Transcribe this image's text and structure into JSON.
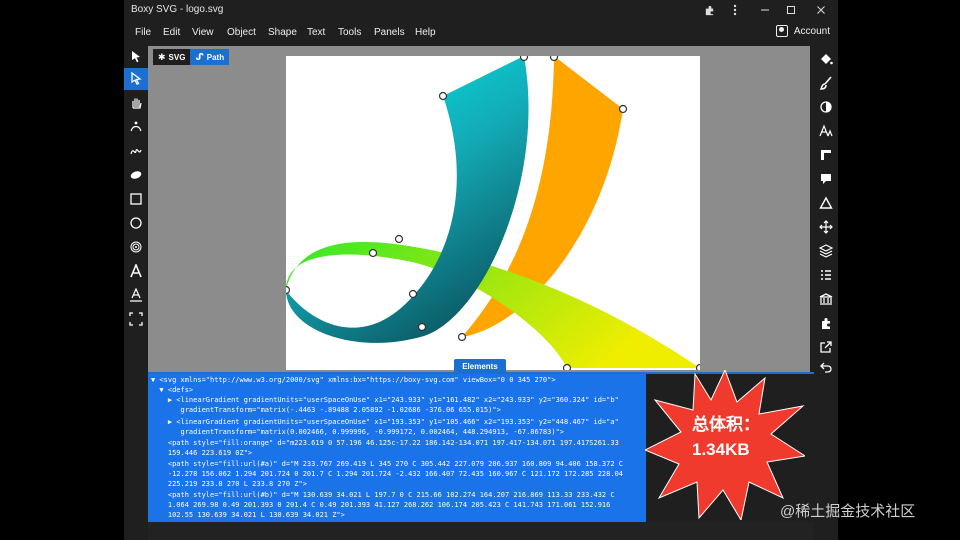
{
  "window": {
    "title": "Boxy SVG - logo.svg"
  },
  "menu": {
    "items": [
      "File",
      "Edit",
      "View",
      "Object",
      "Shape",
      "Text",
      "Tools",
      "Panels",
      "Help"
    ],
    "account_label": "Account"
  },
  "breadcrumbs": {
    "svg_label": "SVG",
    "path_label": "Path"
  },
  "panel": {
    "tab_label": "Elements"
  },
  "code": {
    "lines": [
      "▼ <svg xmlns=\"http://www.w3.org/2000/svg\" xmlns:bx=\"https://boxy-svg.com\" viewBox=\"0 0 345 270\">",
      "  ▼ <defs>",
      "    ▶ <linearGradient gradientUnits=\"userSpaceOnUse\" x1=\"243.933\" y1=\"161.482\" x2=\"243.933\" y2=\"360.324\" id=\"b\"",
      "       gradientTransform=\"matrix(-.4463 -.89488 2.05892 -1.02686 -376.06 655.015)\">",
      "    ▶ <linearGradient gradientUnits=\"userSpaceOnUse\" x1=\"193.353\" y1=\"105.466\" x2=\"193.353\" y2=\"448.467\" id=\"a\"",
      "       gradientTransform=\"matrix(0.002466, 0.999996, -0.999172, 0.002464, 448.294913, -67.86783)\">",
      "    <path style=\"fill:orange\" d=\"m223.619 0 57.196 46.125c-17.22 186.142-134.071 197.417-134.071 197.417S261.33",
      "    159.446 223.619 0Z\">",
      "    <path style=\"fill:url(#a)\" d=\"M 233.767 269.419 L 345 270 C 305.442 227.079 206.937 160.809 94.406 158.372 C",
      "    -12.278 156.062 1.294 201.724 0 201.7 C 1.294 201.724 -2.432 166.407 72.435 160.967 C 121.172 172.285 228.04",
      "    225.219 233.8 270 L 233.8 270 Z\">",
      "    <path style=\"fill:url(#b)\" d=\"M 130.639 34.021 L 197.7 0 C 215.66 102.274 164.207 216.869 113.33 233.432 C",
      "    1.064 269.98 0.49 201.393 0 201.4 C 0.49 201.393 41.127 268.262 106.174 205.423 C 141.743 171.061 152.916",
      "    102.55 130.639 34.021 L 130.639 34.021 Z\">"
    ]
  },
  "overlay": {
    "size_label": "总体积：",
    "size_value": "1.34KB"
  },
  "watermark": "@稀土掘金技术社区",
  "colors": {
    "accent": "#1a6fcf",
    "panel": "#1a73e8",
    "orange": "#ffa500",
    "burst": "#f03a2e"
  },
  "icons": {
    "left_tools": [
      "pointer-icon",
      "node-pointer-icon",
      "hand-icon",
      "curve-icon",
      "freehand-icon",
      "ellipse-blob-icon",
      "rectangle-icon",
      "circle-icon",
      "spiral-icon",
      "text-icon",
      "text-path-icon",
      "crop-icon"
    ],
    "right_tools": [
      "fill-bucket-icon",
      "brush-icon",
      "contrast-icon",
      "typography-icon",
      "ruler-icon",
      "comment-icon",
      "triangle-icon",
      "move-arrows-icon",
      "layers-icon",
      "list-icon",
      "library-icon",
      "puzzle-icon",
      "export-icon",
      "undo-icon"
    ]
  }
}
